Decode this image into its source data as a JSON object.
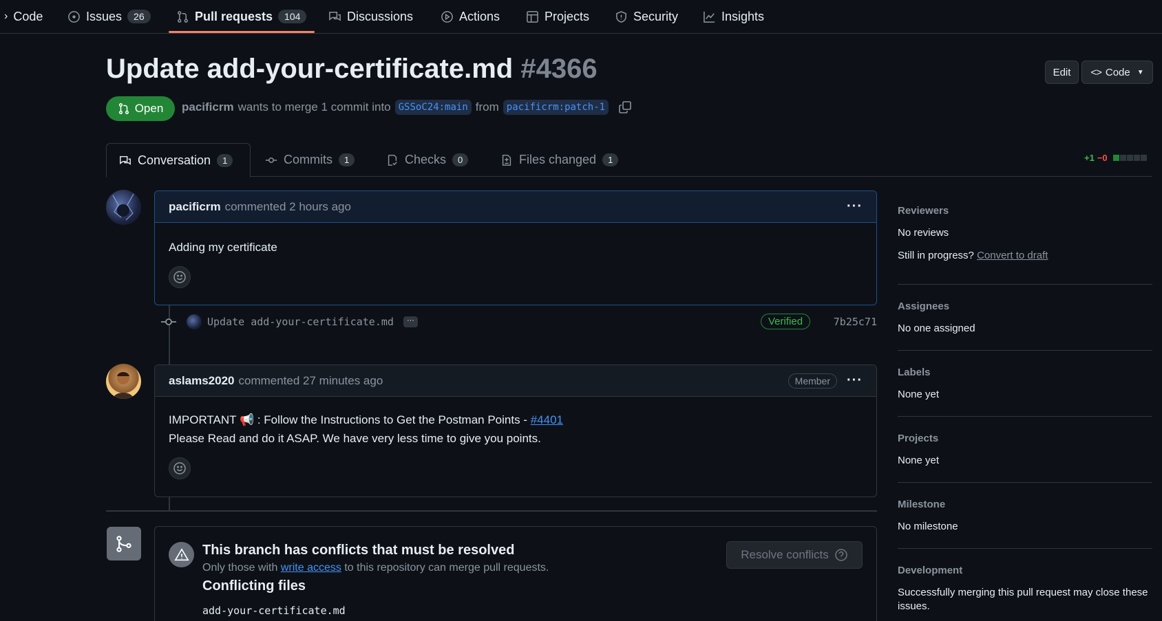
{
  "repo_nav": {
    "items": [
      {
        "label": "Code",
        "count": ""
      },
      {
        "label": "Issues",
        "count": "26"
      },
      {
        "label": "Pull requests",
        "count": "104"
      },
      {
        "label": "Discussions",
        "count": ""
      },
      {
        "label": "Actions",
        "count": ""
      },
      {
        "label": "Projects",
        "count": ""
      },
      {
        "label": "Security",
        "count": ""
      },
      {
        "label": "Insights",
        "count": ""
      }
    ],
    "active": "Pull requests"
  },
  "header": {
    "title": "Update add-your-certificate.md",
    "number": "#4366",
    "edit_label": "Edit",
    "code_label": "Code",
    "state": "Open",
    "author": "pacificrm",
    "merge_text": "wants to merge 1 commit into",
    "base_branch": "GSSoC24:main",
    "from_text": "from",
    "head_branch": "pacificrm:patch-1"
  },
  "tabs": [
    {
      "label": "Conversation",
      "count": "1"
    },
    {
      "label": "Commits",
      "count": "1"
    },
    {
      "label": "Checks",
      "count": "0"
    },
    {
      "label": "Files changed",
      "count": "1"
    }
  ],
  "diffstat": {
    "additions": "+1",
    "deletions": "−0",
    "blocks": [
      "#238636",
      "#30363d",
      "#30363d",
      "#30363d",
      "#30363d"
    ]
  },
  "comments": [
    {
      "author": "pacificrm",
      "action": "commented",
      "time": "2 hours ago",
      "body": "Adding my certificate"
    },
    {
      "author": "aslams2020",
      "action": "commented",
      "time": "27 minutes ago",
      "role": "Member",
      "body_line1": "IMPORTANT 📢 : Follow the Instructions to Get the Postman Points - ",
      "body_link": "#4401",
      "body_line2": "Please Read and do it ASAP. We have very less time to give you points."
    }
  ],
  "commit": {
    "message": "Update add-your-certificate.md",
    "more": "···",
    "verified": "Verified",
    "sha": "7b25c71"
  },
  "merge": {
    "title": "This branch has conflicts that must be resolved",
    "sub_prefix": "Only those with",
    "sub_link": "write access",
    "sub_suffix": "to this repository can merge pull requests.",
    "files_title": "Conflicting files",
    "file": "add-your-certificate.md",
    "resolve_label": "Resolve conflicts"
  },
  "sidebar": {
    "reviewers": {
      "title": "Reviewers",
      "value": "No reviews",
      "draft_prefix": "Still in progress?",
      "draft_link": "Convert to draft"
    },
    "assignees": {
      "title": "Assignees",
      "value": "No one assigned"
    },
    "labels": {
      "title": "Labels",
      "value": "None yet"
    },
    "projects": {
      "title": "Projects",
      "value": "None yet"
    },
    "milestone": {
      "title": "Milestone",
      "value": "No milestone"
    },
    "development": {
      "title": "Development",
      "value": "Successfully merging this pull request may close these issues."
    }
  }
}
